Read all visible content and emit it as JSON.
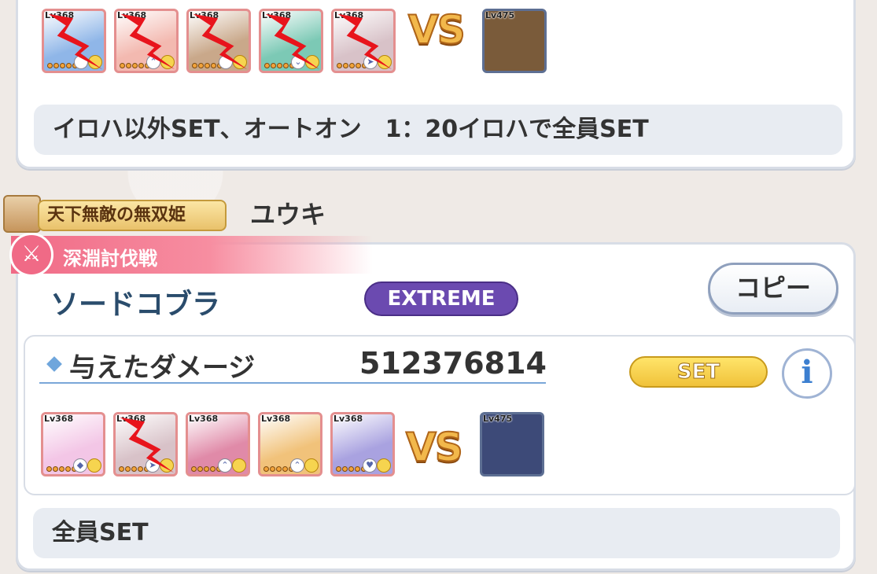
{
  "record1": {
    "team": [
      {
        "level": "Lv368",
        "color": "#8fb6e8",
        "role": "",
        "crossed": true
      },
      {
        "level": "Lv368",
        "color": "#f3b9b0",
        "role": "⌃",
        "crossed": true
      },
      {
        "level": "Lv368",
        "color": "#c9a88a",
        "role": "",
        "crossed": true
      },
      {
        "level": "Lv368",
        "color": "#7cc9b5",
        "role": "⌄",
        "crossed": true
      },
      {
        "level": "Lv368",
        "color": "#d8c2c8",
        "role": "➤",
        "crossed": true
      }
    ],
    "vs_label": "VS",
    "boss": {
      "level": "Lv475",
      "color": "#7a5b3a"
    },
    "memo": "イロハ以外SET、オートオン　1：20イロハで全員SET"
  },
  "header": {
    "title_badge": "天下無敵の無双姫",
    "player_name": "ユウキ"
  },
  "record2": {
    "mode_label": "深淵討伐戦",
    "mode_icon": "crossed-swords-icon",
    "boss_name": "ソードコブラ",
    "difficulty": "EXTREME",
    "copy_label": "コピー",
    "damage_label": "与えたダメージ",
    "damage_value": "512376814",
    "set_label": "SET",
    "info_label": "i",
    "team": [
      {
        "level": "Lv368",
        "color": "#f3c6e6",
        "role": "◆",
        "crossed": false
      },
      {
        "level": "Lv368",
        "color": "#d8c2c8",
        "role": "➤",
        "crossed": true
      },
      {
        "level": "Lv368",
        "color": "#e08aa8",
        "role": "⌃",
        "crossed": false
      },
      {
        "level": "Lv368",
        "color": "#f1c27a",
        "role": "⌃",
        "crossed": false
      },
      {
        "level": "Lv368",
        "color": "#a9a2e0",
        "role": "♥",
        "crossed": false
      }
    ],
    "vs_label": "VS",
    "boss": {
      "level": "Lv475",
      "color": "#3d4a78"
    },
    "memo": "全員SET"
  }
}
